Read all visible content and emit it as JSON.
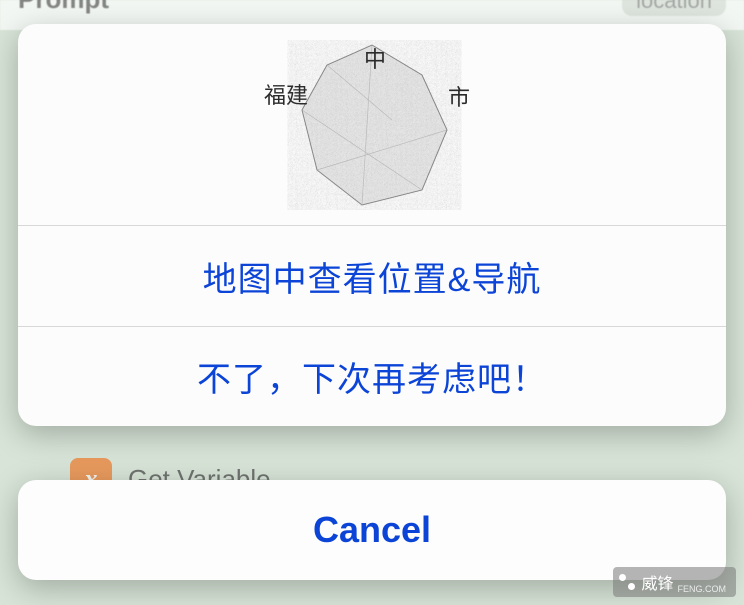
{
  "background": {
    "prompt_label": "Prompt",
    "location_chip": "location",
    "action_row": {
      "icon_glyph": "x",
      "label": "Get Variable"
    }
  },
  "map_art": {
    "label_top": "中",
    "label_left": "福建",
    "label_right": "市"
  },
  "action_sheet": {
    "options": [
      {
        "label": "地图中查看位置&导航"
      },
      {
        "label": "不了，下次再考虑吧！"
      }
    ],
    "cancel_label": "Cancel"
  },
  "watermark": {
    "text": "威锋",
    "sub": "FENG.COM"
  }
}
